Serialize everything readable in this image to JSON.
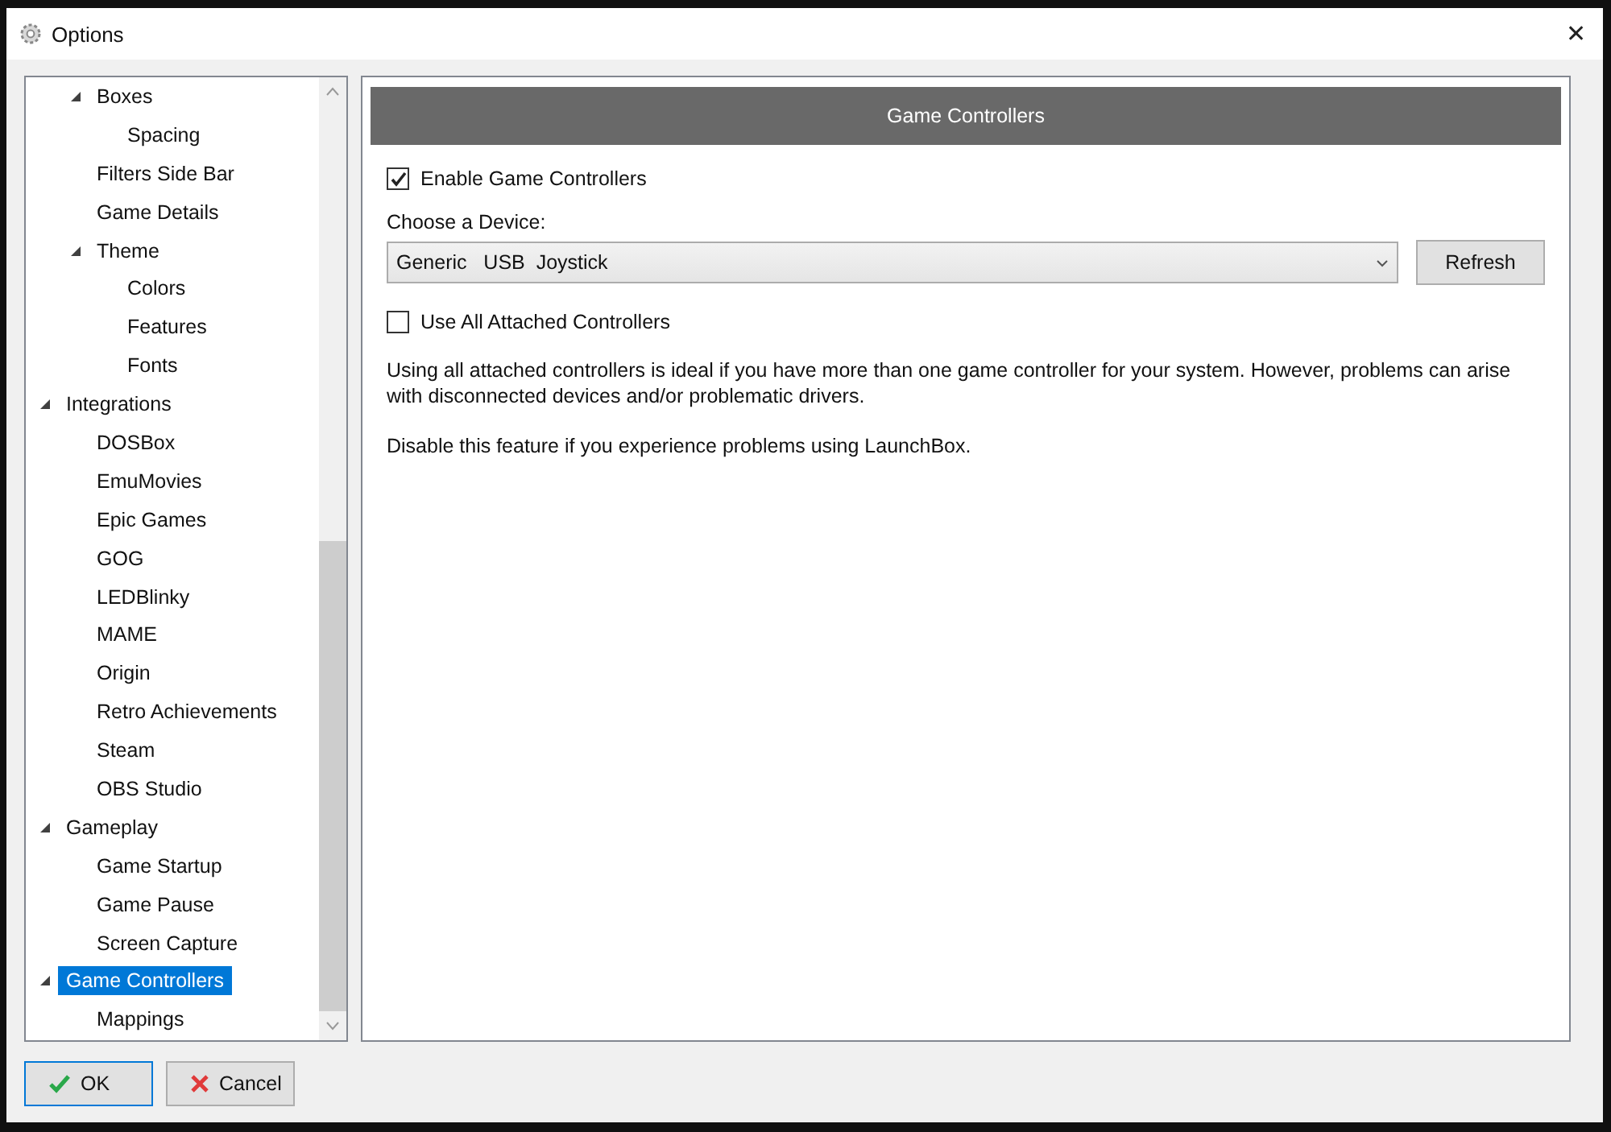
{
  "window": {
    "title": "Options",
    "close": "✕"
  },
  "tree": {
    "items": [
      {
        "children": [
          {
            "label": "Boxes",
            "selected": false,
            "expanded": true,
            "children": [
              {
                "label": "Spacing",
                "selected": false
              }
            ]
          },
          {
            "label": "Filters Side Bar",
            "selected": false
          },
          {
            "label": "Game Details",
            "selected": false
          },
          {
            "label": "Theme",
            "selected": false,
            "expanded": true,
            "children": [
              {
                "label": "Colors",
                "selected": false
              },
              {
                "label": "Features",
                "selected": false
              },
              {
                "label": "Fonts",
                "selected": false
              }
            ]
          }
        ]
      },
      {
        "label": "Integrations",
        "selected": false,
        "expanded": true,
        "children": [
          {
            "label": "DOSBox",
            "selected": false
          },
          {
            "label": "EmuMovies",
            "selected": false
          },
          {
            "label": "Epic Games",
            "selected": false
          },
          {
            "label": "GOG",
            "selected": false
          },
          {
            "label": "LEDBlinky",
            "selected": false
          },
          {
            "label": "MAME",
            "selected": false
          },
          {
            "label": "Origin",
            "selected": false
          },
          {
            "label": "Retro Achievements",
            "selected": false
          },
          {
            "label": "Steam",
            "selected": false
          },
          {
            "label": "OBS Studio",
            "selected": false
          }
        ]
      },
      {
        "label": "Gameplay",
        "selected": false,
        "expanded": true,
        "children": [
          {
            "label": "Game Startup",
            "selected": false
          },
          {
            "label": "Game Pause",
            "selected": false
          },
          {
            "label": "Screen Capture",
            "selected": false
          }
        ]
      },
      {
        "label": "Game Controllers",
        "selected": true,
        "expanded": true,
        "children": [
          {
            "label": "Mappings",
            "selected": false
          }
        ]
      }
    ]
  },
  "panel": {
    "header": "Game Controllers",
    "enable": {
      "label": "Enable Game Controllers",
      "checked": true
    },
    "device_label": "Choose a Device:",
    "device": {
      "value": "Generic   USB  Joystick"
    },
    "refresh": "Refresh",
    "use_all": {
      "label": "Use All Attached Controllers",
      "checked": false
    },
    "paragraphs": [
      "Using all attached controllers is ideal if you have more than one game controller for your system. However, problems can arise with disconnected devices and/or problematic drivers.",
      "Disable this feature if you experience problems using LaunchBox."
    ]
  },
  "buttons": [
    {
      "kind": "ok",
      "label": "OK"
    },
    {
      "kind": "cancel",
      "label": "Cancel"
    }
  ]
}
